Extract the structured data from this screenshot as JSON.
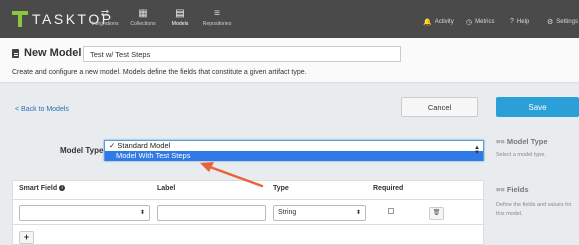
{
  "nav": {
    "logo": "TASKTOP",
    "items": [
      {
        "label": "Integrations",
        "icon": "⇄"
      },
      {
        "label": "Collections",
        "icon": "▦"
      },
      {
        "label": "Models",
        "icon": "▤"
      },
      {
        "label": "Repositories",
        "icon": "≡"
      }
    ],
    "right": [
      {
        "label": "Activity",
        "icon": "🔔"
      },
      {
        "label": "Metrics",
        "icon": "◷"
      },
      {
        "label": "Help",
        "icon": "?"
      },
      {
        "label": "Settings",
        "icon": "⚙"
      }
    ]
  },
  "header": {
    "title": "New Model",
    "name_value": "Test w/ Test Steps",
    "subtitle": "Create and configure a new model. Models define the fields that constitute a given artifact type."
  },
  "actions": {
    "back": "< Back to Models",
    "cancel": "Cancel",
    "save": "Save"
  },
  "model_type": {
    "label": "Model Type",
    "options": [
      "✓ Standard Model",
      "Model With Test Steps"
    ],
    "selected_index": 1
  },
  "sidebar": {
    "model_type_heading": "≡≡ Model Type",
    "model_type_help": "Select a model type.",
    "fields_heading": "≡≡ Fields",
    "fields_help": "Define the fields and values for this model."
  },
  "fields_table": {
    "headers": [
      "Smart Field",
      "Label",
      "Type",
      "Required"
    ],
    "row": {
      "smart_field": "",
      "label": "",
      "type": "String"
    }
  },
  "colors": {
    "nav_bg": "#4a4a4a",
    "logo_green": "#8cc63f",
    "save_blue": "#2a9fd8",
    "highlight": "#2f7ae5",
    "annotation_arrow": "#e8643c"
  }
}
